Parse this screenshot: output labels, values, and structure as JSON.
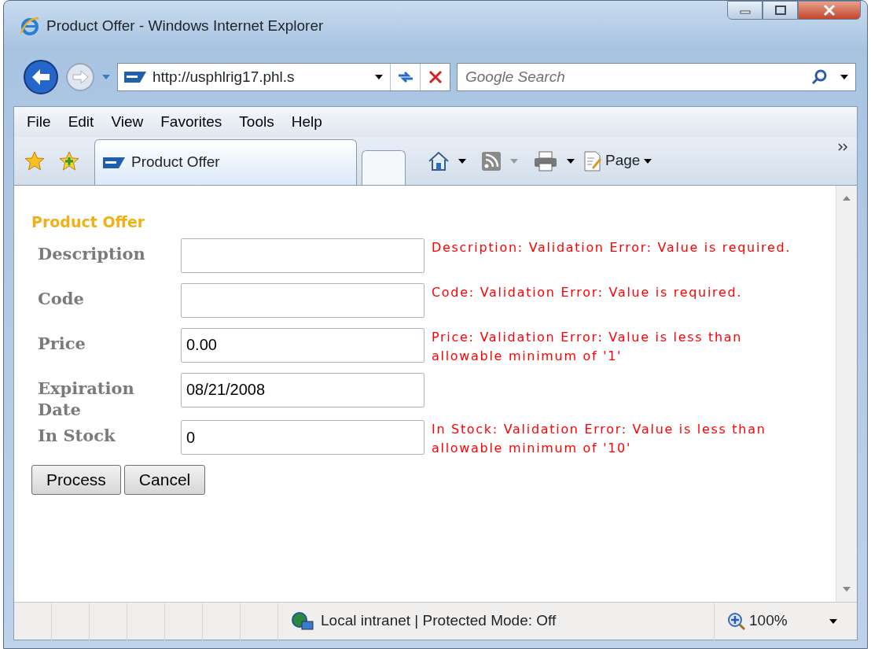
{
  "window": {
    "title": "Product Offer - Windows Internet Explorer"
  },
  "address": {
    "url": "http://usphlrig17.phl.s"
  },
  "search": {
    "placeholder": "Google Search"
  },
  "menu": [
    "File",
    "Edit",
    "View",
    "Favorites",
    "Tools",
    "Help"
  ],
  "tabs": [
    {
      "label": "Product Offer",
      "selected": true
    }
  ],
  "command_bar": {
    "page_label": "Page"
  },
  "form": {
    "title": "Product Offer",
    "fields": [
      {
        "label": "Description",
        "error": "Description: Validation Error: Value is required."
      },
      {
        "label": "Code",
        "error": "Code: Validation Error: Value is required."
      },
      {
        "label": "Price",
        "value": "0.00",
        "error": "Price: Validation Error: Value is less than allowable minimum of '1'"
      },
      {
        "label": "Expiration Date",
        "value": "08/21/2008"
      },
      {
        "label": "In Stock",
        "value": "0",
        "error": "In Stock: Validation Error: Value is less than allowable minimum of '10'"
      }
    ],
    "buttons": [
      "Process",
      "Cancel"
    ]
  },
  "status_bar": {
    "zone": "Local intranet | Protected Mode: Off",
    "zoom": "100%"
  }
}
